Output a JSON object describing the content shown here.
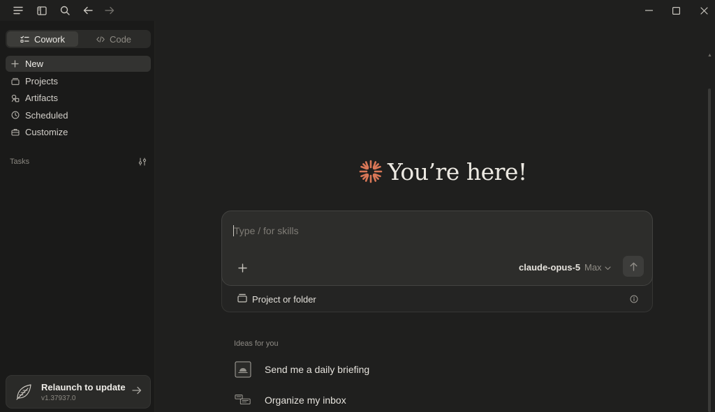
{
  "titlebar": {
    "icons": [
      "menu-icon",
      "sidebar-toggle-icon",
      "search-icon",
      "back-arrow-icon",
      "forward-arrow-icon"
    ],
    "window_controls": [
      "minimize-icon",
      "maximize-icon",
      "close-icon"
    ]
  },
  "sidebar": {
    "mode_toggle": {
      "cowork_label": "Cowork",
      "code_label": "Code",
      "active": "Cowork"
    },
    "nav": [
      {
        "label": "New",
        "icon": "plus-icon",
        "active": true
      },
      {
        "label": "Projects",
        "icon": "projects-icon"
      },
      {
        "label": "Artifacts",
        "icon": "artifacts-icon"
      },
      {
        "label": "Scheduled",
        "icon": "clock-icon"
      },
      {
        "label": "Customize",
        "icon": "briefcase-icon"
      }
    ],
    "tasks_label": "Tasks",
    "update": {
      "title": "Relaunch to update",
      "version": "v1.37937.0"
    }
  },
  "main": {
    "greeting": "You’re here!",
    "composer": {
      "placeholder": "Type / for skills",
      "model": "claude-opus-5",
      "effort": "Max"
    },
    "project_picker": {
      "label": "Project or folder"
    },
    "ideas": {
      "label": "Ideas for you",
      "items": [
        {
          "label": "Send me a daily briefing",
          "icon": "briefing-icon"
        },
        {
          "label": "Organize my inbox",
          "icon": "inbox-icon"
        }
      ]
    }
  },
  "colors": {
    "background": "#1f1f1e",
    "sidebar": "#1a1a19",
    "accent": "#d97757",
    "composer": "#2d2d2b"
  }
}
